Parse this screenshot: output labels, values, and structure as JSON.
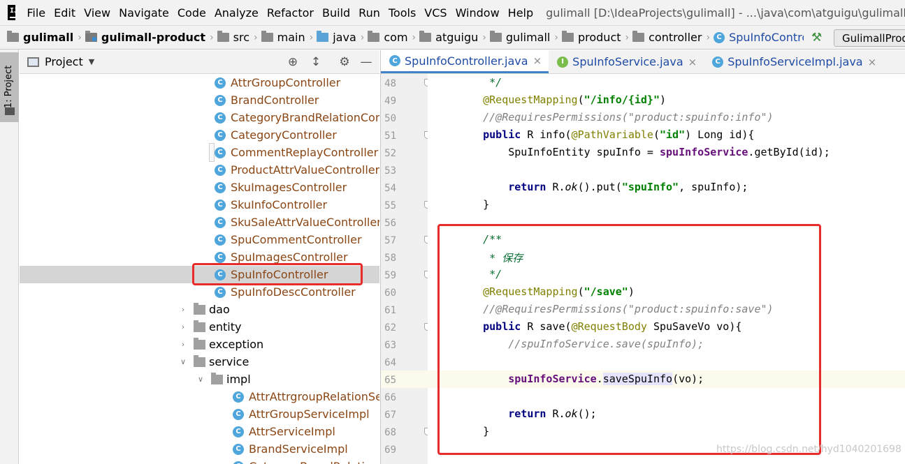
{
  "menubar": {
    "items": [
      "File",
      "Edit",
      "View",
      "Navigate",
      "Code",
      "Analyze",
      "Refactor",
      "Build",
      "Run",
      "Tools",
      "VCS",
      "Window",
      "Help"
    ],
    "window_title": "gulimall [D:\\IdeaProjects\\gulimall] - ...\\java\\com\\atguigu\\gulimall\\product\\controller\\SpuInfoController.java [gulimall-product]"
  },
  "breadcrumbs": [
    "gulimall",
    "gulimall-product",
    "src",
    "main",
    "java",
    "com",
    "atguigu",
    "gulimall",
    "product",
    "controller",
    "SpuInfoController"
  ],
  "run_config": {
    "label": "GulimallProductApplication"
  },
  "toolstrip": {
    "project_tab": "1: Project"
  },
  "project_panel": {
    "title": "Project",
    "tree": [
      {
        "label": "AttrGroupController",
        "kind": "class"
      },
      {
        "label": "BrandController",
        "kind": "class"
      },
      {
        "label": "CategoryBrandRelationController",
        "kind": "class"
      },
      {
        "label": "CategoryController",
        "kind": "class"
      },
      {
        "label": "CommentReplayController",
        "kind": "class"
      },
      {
        "label": "ProductAttrValueController",
        "kind": "class"
      },
      {
        "label": "SkuImagesController",
        "kind": "class"
      },
      {
        "label": "SkuInfoController",
        "kind": "class"
      },
      {
        "label": "SkuSaleAttrValueController",
        "kind": "class"
      },
      {
        "label": "SpuCommentController",
        "kind": "class"
      },
      {
        "label": "SpuImagesController",
        "kind": "class"
      },
      {
        "label": "SpuInfoController",
        "kind": "class",
        "selected": true
      },
      {
        "label": "SpuInfoDescController",
        "kind": "class"
      },
      {
        "label": "dao",
        "kind": "package",
        "expanded": false
      },
      {
        "label": "entity",
        "kind": "package",
        "expanded": false
      },
      {
        "label": "exception",
        "kind": "package",
        "expanded": false
      },
      {
        "label": "service",
        "kind": "package",
        "expanded": true
      },
      {
        "label": "impl",
        "kind": "package",
        "expanded": true
      },
      {
        "label": "AttrAttrgroupRelationServiceImpl",
        "kind": "class"
      },
      {
        "label": "AttrGroupServiceImpl",
        "kind": "class"
      },
      {
        "label": "AttrServiceImpl",
        "kind": "class"
      },
      {
        "label": "BrandServiceImpl",
        "kind": "class"
      },
      {
        "label": "CategoryBrandRelationServiceImpl",
        "kind": "class"
      }
    ]
  },
  "editor": {
    "tabs": [
      {
        "label": "SpuInfoController.java",
        "icon": "C",
        "active": true
      },
      {
        "label": "SpuInfoService.java",
        "icon": "I",
        "active": false
      },
      {
        "label": "SpuInfoServiceImpl.java",
        "icon": "C",
        "active": false
      }
    ],
    "current_line": 65,
    "lines": [
      {
        "n": "48",
        "text": "     */"
      },
      {
        "n": "49",
        "text": "    @RequestMapping(\"/info/{id}\")"
      },
      {
        "n": "50",
        "text": "    //@RequiresPermissions(\"product:spuinfo:info\")"
      },
      {
        "n": "51",
        "text": "    public R info(@PathVariable(\"id\") Long id){"
      },
      {
        "n": "52",
        "text": "        SpuInfoEntity spuInfo = spuInfoService.getById(id);"
      },
      {
        "n": "53",
        "text": ""
      },
      {
        "n": "54",
        "text": "        return R.ok().put(\"spuInfo\", spuInfo);"
      },
      {
        "n": "55",
        "text": "    }"
      },
      {
        "n": "56",
        "text": ""
      },
      {
        "n": "57",
        "text": "    /**"
      },
      {
        "n": "58",
        "text": "     * 保存"
      },
      {
        "n": "59",
        "text": "     */"
      },
      {
        "n": "60",
        "text": "    @RequestMapping(\"/save\")"
      },
      {
        "n": "61",
        "text": "    //@RequiresPermissions(\"product:spuinfo:save\")"
      },
      {
        "n": "62",
        "text": "    public R save(@RequestBody SpuSaveVo vo){"
      },
      {
        "n": "63",
        "text": "        //spuInfoService.save(spuInfo);"
      },
      {
        "n": "64",
        "text": ""
      },
      {
        "n": "65",
        "text": "        spuInfoService.saveSpuInfo(vo);"
      },
      {
        "n": "66",
        "text": ""
      },
      {
        "n": "67",
        "text": "        return R.ok();"
      },
      {
        "n": "68",
        "text": "    }"
      },
      {
        "n": "69",
        "text": ""
      }
    ]
  },
  "watermark": "https://blog.csdn.net/hyd1040201698",
  "colors": {
    "annotation_box": "#e82c2c",
    "selection": "#d5d5d5",
    "current_line": "#fcfaed"
  }
}
